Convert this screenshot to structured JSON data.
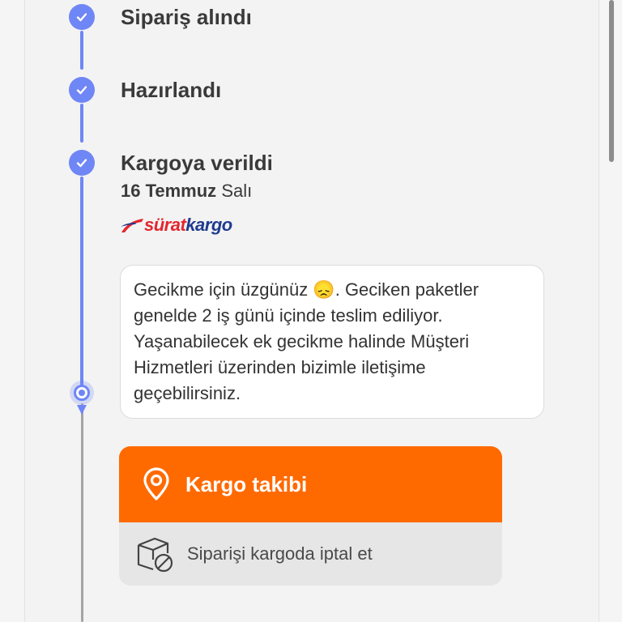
{
  "timeline": {
    "steps": [
      {
        "title": "Sipariş alındı",
        "done": true
      },
      {
        "title": "Hazırlandı",
        "done": true
      },
      {
        "title": "Kargoya verildi",
        "done": true
      }
    ],
    "shipped_date": {
      "day": "16 Temmuz",
      "weekday": "Salı"
    },
    "carrier": {
      "logo_text_1": "sürat",
      "logo_text_2": "kargo",
      "logo_icon": "surat-kargo-logo"
    },
    "delay_message": "Gecikme için üzgünüz 😞. Geciken paketler genelde 2 iş günü içinde teslim ediliyor. Yaşanabilecek ek gecikme halinde Müşteri Hizmetleri üzerinden bizimle iletişime geçebilirsiniz."
  },
  "actions": {
    "track_label": "Kargo takibi",
    "track_icon": "location-pin-icon",
    "cancel_label": "Siparişi kargoda iptal et",
    "cancel_icon": "box-cancel-icon"
  },
  "colors": {
    "accent": "#6f86f6",
    "orange": "#ff6a00",
    "gray_line": "#a3a3a3"
  }
}
